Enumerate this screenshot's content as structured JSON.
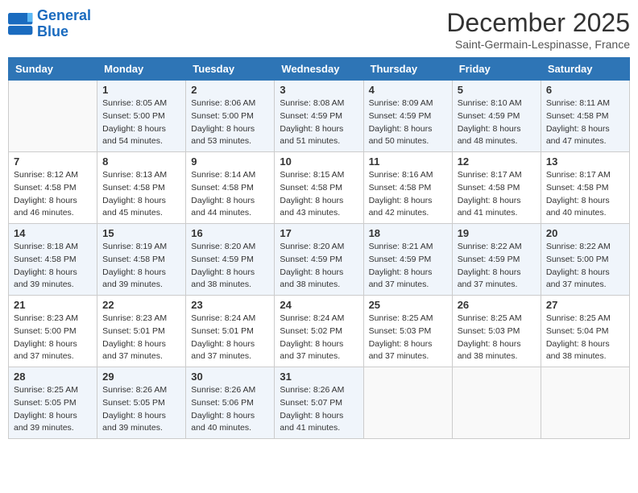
{
  "header": {
    "logo_line1": "General",
    "logo_line2": "Blue",
    "month": "December 2025",
    "location": "Saint-Germain-Lespinasse, France"
  },
  "weekdays": [
    "Sunday",
    "Monday",
    "Tuesday",
    "Wednesday",
    "Thursday",
    "Friday",
    "Saturday"
  ],
  "weeks": [
    [
      {
        "day": "",
        "sunrise": "",
        "sunset": "",
        "daylight": ""
      },
      {
        "day": "1",
        "sunrise": "Sunrise: 8:05 AM",
        "sunset": "Sunset: 5:00 PM",
        "daylight": "Daylight: 8 hours and 54 minutes."
      },
      {
        "day": "2",
        "sunrise": "Sunrise: 8:06 AM",
        "sunset": "Sunset: 5:00 PM",
        "daylight": "Daylight: 8 hours and 53 minutes."
      },
      {
        "day": "3",
        "sunrise": "Sunrise: 8:08 AM",
        "sunset": "Sunset: 4:59 PM",
        "daylight": "Daylight: 8 hours and 51 minutes."
      },
      {
        "day": "4",
        "sunrise": "Sunrise: 8:09 AM",
        "sunset": "Sunset: 4:59 PM",
        "daylight": "Daylight: 8 hours and 50 minutes."
      },
      {
        "day": "5",
        "sunrise": "Sunrise: 8:10 AM",
        "sunset": "Sunset: 4:59 PM",
        "daylight": "Daylight: 8 hours and 48 minutes."
      },
      {
        "day": "6",
        "sunrise": "Sunrise: 8:11 AM",
        "sunset": "Sunset: 4:58 PM",
        "daylight": "Daylight: 8 hours and 47 minutes."
      }
    ],
    [
      {
        "day": "7",
        "sunrise": "Sunrise: 8:12 AM",
        "sunset": "Sunset: 4:58 PM",
        "daylight": "Daylight: 8 hours and 46 minutes."
      },
      {
        "day": "8",
        "sunrise": "Sunrise: 8:13 AM",
        "sunset": "Sunset: 4:58 PM",
        "daylight": "Daylight: 8 hours and 45 minutes."
      },
      {
        "day": "9",
        "sunrise": "Sunrise: 8:14 AM",
        "sunset": "Sunset: 4:58 PM",
        "daylight": "Daylight: 8 hours and 44 minutes."
      },
      {
        "day": "10",
        "sunrise": "Sunrise: 8:15 AM",
        "sunset": "Sunset: 4:58 PM",
        "daylight": "Daylight: 8 hours and 43 minutes."
      },
      {
        "day": "11",
        "sunrise": "Sunrise: 8:16 AM",
        "sunset": "Sunset: 4:58 PM",
        "daylight": "Daylight: 8 hours and 42 minutes."
      },
      {
        "day": "12",
        "sunrise": "Sunrise: 8:17 AM",
        "sunset": "Sunset: 4:58 PM",
        "daylight": "Daylight: 8 hours and 41 minutes."
      },
      {
        "day": "13",
        "sunrise": "Sunrise: 8:17 AM",
        "sunset": "Sunset: 4:58 PM",
        "daylight": "Daylight: 8 hours and 40 minutes."
      }
    ],
    [
      {
        "day": "14",
        "sunrise": "Sunrise: 8:18 AM",
        "sunset": "Sunset: 4:58 PM",
        "daylight": "Daylight: 8 hours and 39 minutes."
      },
      {
        "day": "15",
        "sunrise": "Sunrise: 8:19 AM",
        "sunset": "Sunset: 4:58 PM",
        "daylight": "Daylight: 8 hours and 39 minutes."
      },
      {
        "day": "16",
        "sunrise": "Sunrise: 8:20 AM",
        "sunset": "Sunset: 4:59 PM",
        "daylight": "Daylight: 8 hours and 38 minutes."
      },
      {
        "day": "17",
        "sunrise": "Sunrise: 8:20 AM",
        "sunset": "Sunset: 4:59 PM",
        "daylight": "Daylight: 8 hours and 38 minutes."
      },
      {
        "day": "18",
        "sunrise": "Sunrise: 8:21 AM",
        "sunset": "Sunset: 4:59 PM",
        "daylight": "Daylight: 8 hours and 37 minutes."
      },
      {
        "day": "19",
        "sunrise": "Sunrise: 8:22 AM",
        "sunset": "Sunset: 4:59 PM",
        "daylight": "Daylight: 8 hours and 37 minutes."
      },
      {
        "day": "20",
        "sunrise": "Sunrise: 8:22 AM",
        "sunset": "Sunset: 5:00 PM",
        "daylight": "Daylight: 8 hours and 37 minutes."
      }
    ],
    [
      {
        "day": "21",
        "sunrise": "Sunrise: 8:23 AM",
        "sunset": "Sunset: 5:00 PM",
        "daylight": "Daylight: 8 hours and 37 minutes."
      },
      {
        "day": "22",
        "sunrise": "Sunrise: 8:23 AM",
        "sunset": "Sunset: 5:01 PM",
        "daylight": "Daylight: 8 hours and 37 minutes."
      },
      {
        "day": "23",
        "sunrise": "Sunrise: 8:24 AM",
        "sunset": "Sunset: 5:01 PM",
        "daylight": "Daylight: 8 hours and 37 minutes."
      },
      {
        "day": "24",
        "sunrise": "Sunrise: 8:24 AM",
        "sunset": "Sunset: 5:02 PM",
        "daylight": "Daylight: 8 hours and 37 minutes."
      },
      {
        "day": "25",
        "sunrise": "Sunrise: 8:25 AM",
        "sunset": "Sunset: 5:03 PM",
        "daylight": "Daylight: 8 hours and 37 minutes."
      },
      {
        "day": "26",
        "sunrise": "Sunrise: 8:25 AM",
        "sunset": "Sunset: 5:03 PM",
        "daylight": "Daylight: 8 hours and 38 minutes."
      },
      {
        "day": "27",
        "sunrise": "Sunrise: 8:25 AM",
        "sunset": "Sunset: 5:04 PM",
        "daylight": "Daylight: 8 hours and 38 minutes."
      }
    ],
    [
      {
        "day": "28",
        "sunrise": "Sunrise: 8:25 AM",
        "sunset": "Sunset: 5:05 PM",
        "daylight": "Daylight: 8 hours and 39 minutes."
      },
      {
        "day": "29",
        "sunrise": "Sunrise: 8:26 AM",
        "sunset": "Sunset: 5:05 PM",
        "daylight": "Daylight: 8 hours and 39 minutes."
      },
      {
        "day": "30",
        "sunrise": "Sunrise: 8:26 AM",
        "sunset": "Sunset: 5:06 PM",
        "daylight": "Daylight: 8 hours and 40 minutes."
      },
      {
        "day": "31",
        "sunrise": "Sunrise: 8:26 AM",
        "sunset": "Sunset: 5:07 PM",
        "daylight": "Daylight: 8 hours and 41 minutes."
      },
      {
        "day": "",
        "sunrise": "",
        "sunset": "",
        "daylight": ""
      },
      {
        "day": "",
        "sunrise": "",
        "sunset": "",
        "daylight": ""
      },
      {
        "day": "",
        "sunrise": "",
        "sunset": "",
        "daylight": ""
      }
    ]
  ]
}
